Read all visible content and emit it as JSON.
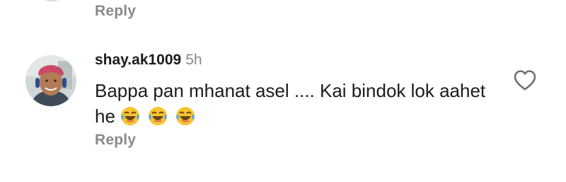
{
  "previous_comment": {
    "reply_label": "Reply"
  },
  "comment": {
    "username": "shay.ak1009",
    "timestamp": "5h",
    "text": "Bappa pan mhanat asel .... Kai bindok lok aahet he",
    "emojis": [
      "joy-emoji",
      "joy-emoji",
      "joy-emoji"
    ],
    "reply_label": "Reply",
    "like_icon": "heart-outline-icon"
  }
}
